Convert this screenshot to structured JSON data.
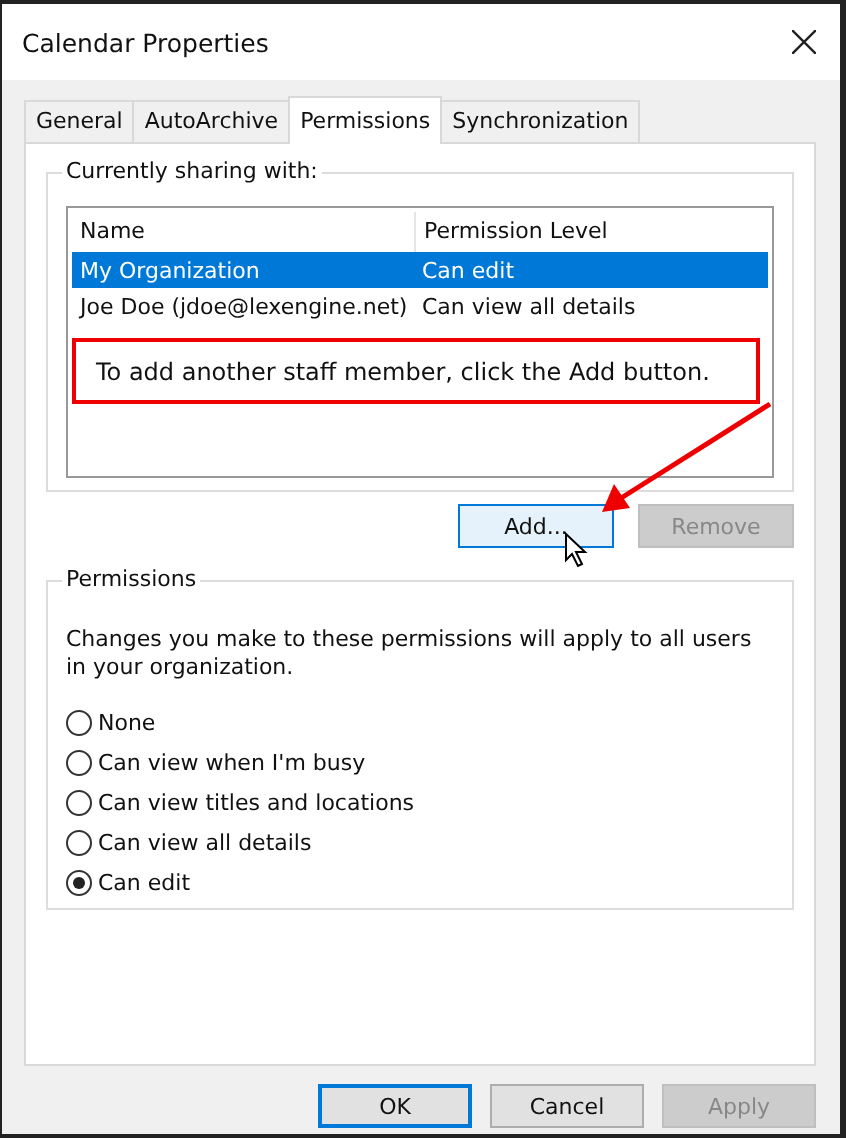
{
  "window": {
    "title": "Calendar Properties"
  },
  "tabs": [
    {
      "label": "General",
      "selected": false
    },
    {
      "label": "AutoArchive",
      "selected": false
    },
    {
      "label": "Permissions",
      "selected": true
    },
    {
      "label": "Synchronization",
      "selected": false
    }
  ],
  "sharing": {
    "label": "Currently sharing with:",
    "columns": [
      "Name",
      "Permission Level"
    ],
    "rows": [
      {
        "name": "My Organization",
        "level_text": "Can edit",
        "selected": true
      },
      {
        "name": "Joe Doe (jdoe@lexengine.net)",
        "level_text": "Can view all details",
        "selected": false
      }
    ],
    "buttons": [
      {
        "label": "Add...",
        "disabled": false,
        "focused": true
      },
      {
        "label": "Remove",
        "disabled": true,
        "focused": false
      }
    ]
  },
  "callout": {
    "text": "To add another staff member, click the Add button."
  },
  "permissions": {
    "label": "Permissions",
    "description": "Changes you make to these permissions will apply to all users in your organization.",
    "options": [
      {
        "label": "None",
        "selected": false
      },
      {
        "label": "Can view when I'm busy",
        "selected": false
      },
      {
        "label": "Can view titles and locations",
        "selected": false
      },
      {
        "label": "Can view all details",
        "selected": false
      },
      {
        "label": "Can edit",
        "selected": true
      }
    ]
  },
  "footer": [
    {
      "label": "OK",
      "disabled": false,
      "focused": true
    },
    {
      "label": "Cancel",
      "disabled": false,
      "focused": false
    },
    {
      "label": "Apply",
      "disabled": true,
      "focused": false
    }
  ]
}
